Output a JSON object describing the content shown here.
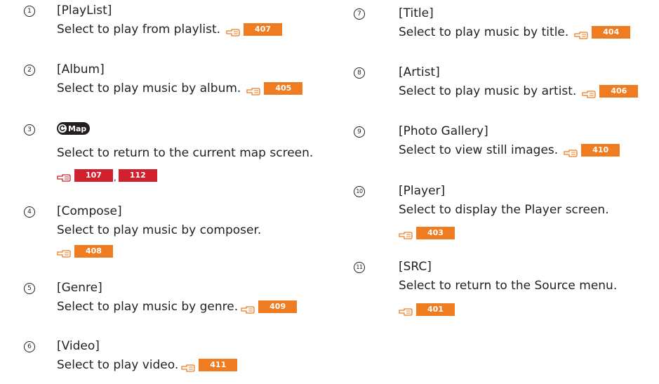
{
  "left_items": [
    {
      "num": "1",
      "label": "[PlayList]",
      "desc": "Select to play from playlist.",
      "ref": "407"
    },
    {
      "num": "2",
      "label": "[Album]",
      "desc": "Select to play music by album.",
      "ref": "405"
    },
    {
      "num": "3",
      "button": "Map",
      "desc": "Select to return to the current map screen.",
      "refs": [
        "107",
        "112"
      ]
    },
    {
      "num": "4",
      "label": "[Compose]",
      "desc": "Select to play music by composer.",
      "ref": "408"
    },
    {
      "num": "5",
      "label": "[Genre]",
      "desc": "Select to play music by genre.",
      "ref": "409"
    },
    {
      "num": "6",
      "label": "[Video]",
      "desc": "Select to play video.",
      "ref": "411"
    }
  ],
  "right_items": [
    {
      "num": "7",
      "label": "[Title]",
      "desc": "Select to play music by title.",
      "ref": "404"
    },
    {
      "num": "8",
      "label": "[Artist]",
      "desc": "Select to play music by artist.",
      "ref": "406"
    },
    {
      "num": "9",
      "label": "[Photo Gallery]",
      "desc": "Select to view still images.",
      "ref": "410"
    },
    {
      "num": "10",
      "label": "[Player]",
      "desc": "Select to display the Player screen.",
      "ref": "403"
    },
    {
      "num": "11",
      "label": "[SRC]",
      "desc": "Select to return to the Source menu.",
      "ref": "401"
    }
  ],
  "colors": {
    "ref_badge": "#f07c22",
    "ref_badge_alt": "#d2202f",
    "text": "#231f20"
  },
  "icons": {
    "reference": "pointing-hand-icon",
    "map_button": "return-arrow-icon"
  }
}
